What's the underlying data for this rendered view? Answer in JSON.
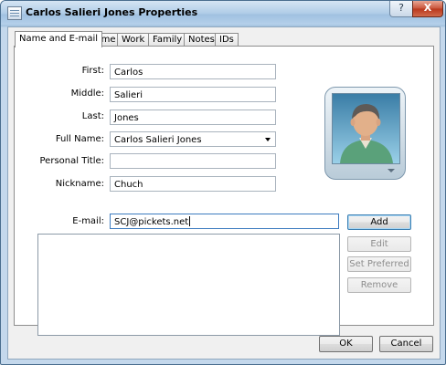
{
  "window": {
    "title": "Carlos Salieri Jones Properties",
    "help_label": "?",
    "close_label": "X"
  },
  "tabs": [
    "Name and E-mail",
    "Home",
    "Work",
    "Family",
    "Notes",
    "IDs"
  ],
  "active_tab": "Name and E-mail",
  "form": {
    "first_label": "First:",
    "first_value": "Carlos",
    "middle_label": "Middle:",
    "middle_value": "Salieri",
    "last_label": "Last:",
    "last_value": "Jones",
    "fullname_label": "Full Name:",
    "fullname_value": "Carlos Salieri Jones",
    "title_label": "Personal Title:",
    "title_value": "",
    "nickname_label": "Nickname:",
    "nickname_value": "Chuch",
    "email_label": "E-mail:",
    "email_value": "SCJ@pickets.net"
  },
  "email_buttons": {
    "add": "Add",
    "edit": "Edit",
    "set_preferred": "Set Preferred",
    "remove": "Remove"
  },
  "footer": {
    "ok": "OK",
    "cancel": "Cancel"
  },
  "colors": {
    "titlebar": "#a9c7e3",
    "close_button": "#c8543a",
    "default_button_border": "#3c7fb1",
    "avatar_shirt": "#5aa17a"
  }
}
